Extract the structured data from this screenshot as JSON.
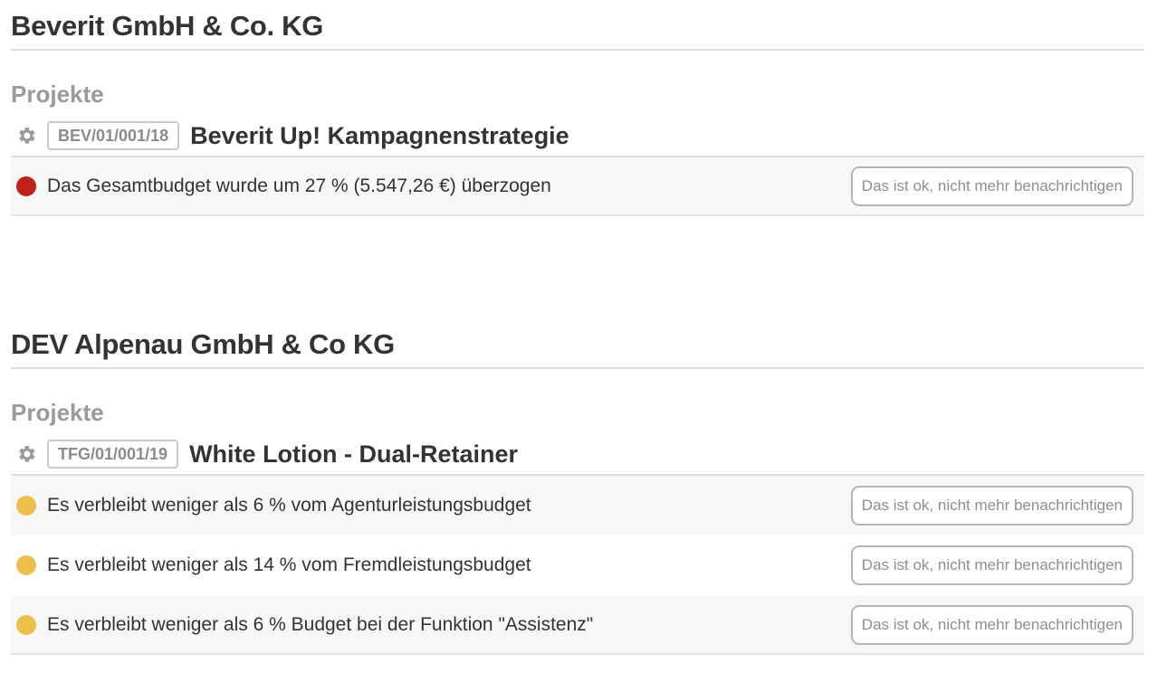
{
  "companies": [
    {
      "name": "Beverit GmbH & Co. KG",
      "section": "Projekte",
      "project": {
        "code": "BEV/01/001/18",
        "name": "Beverit Up! Kampagnenstrategie"
      },
      "alerts": [
        {
          "status_color": "#c0211a",
          "text": "Das Gesamtbudget wurde um 27 % (5.547,26 €) überzogen",
          "button": "Das ist ok, nicht mehr benachrichtigen"
        }
      ]
    },
    {
      "name": "DEV Alpenau GmbH & Co KG",
      "section": "Projekte",
      "project": {
        "code": "TFG/01/001/19",
        "name": "White Lotion - Dual-Retainer"
      },
      "alerts": [
        {
          "status_color": "#ecbf4b",
          "text": "Es verbleibt weniger als 6 % vom Agenturleistungsbudget",
          "button": "Das ist ok, nicht mehr benachrichtigen"
        },
        {
          "status_color": "#ecbf4b",
          "text": "Es verbleibt weniger als 14 % vom Fremdleistungsbudget",
          "button": "Das ist ok, nicht mehr benachrichtigen"
        },
        {
          "status_color": "#ecbf4b",
          "text": "Es verbleibt weniger als 6 % Budget bei der Funktion \"Assistenz\"",
          "button": "Das ist ok, nicht mehr benachrichtigen"
        }
      ]
    }
  ],
  "icons": {
    "settings": "gear-icon",
    "status": "status-dot"
  }
}
